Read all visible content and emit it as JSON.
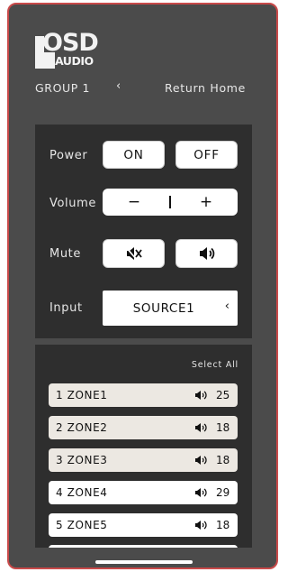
{
  "header": {
    "logo_main": "OSD",
    "logo_sub": "AUDIO",
    "group_label": "GROUP 1",
    "group_chevron": "‹",
    "return_home": "Return Home"
  },
  "controls": {
    "power": {
      "label": "Power",
      "on_label": "ON",
      "off_label": "OFF"
    },
    "volume": {
      "label": "Volume",
      "minus_label": "−",
      "plus_label": "+"
    },
    "mute": {
      "label": "Mute",
      "mute_icon": "speaker-muted-icon",
      "unmute_icon": "speaker-icon"
    },
    "input": {
      "label": "Input",
      "value": "SOURCE1",
      "chevron": "‹"
    }
  },
  "zones": {
    "select_all": "Select All",
    "items": [
      {
        "name": "1 ZONE1",
        "volume": "25",
        "selected": true
      },
      {
        "name": "2 ZONE2",
        "volume": "18",
        "selected": true
      },
      {
        "name": "3 ZONE3",
        "volume": "18",
        "selected": true
      },
      {
        "name": "4 ZONE4",
        "volume": "29",
        "selected": false
      },
      {
        "name": "5 ZONE5",
        "volume": "18",
        "selected": false
      },
      {
        "name": "",
        "volume": "",
        "selected": false
      }
    ]
  },
  "colors": {
    "background": "#4b4b4b",
    "panel": "#2e2e2e",
    "frame_border": "#c94a4a",
    "selected_zone": "#ece8e2"
  }
}
